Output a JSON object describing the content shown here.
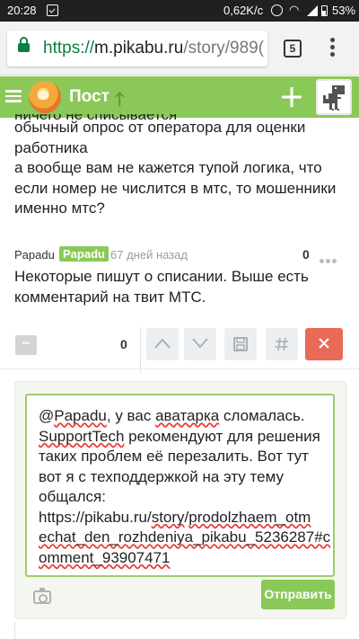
{
  "status_bar": {
    "time": "20:28",
    "network_speed": "0,62K/c",
    "battery": "53%"
  },
  "browser": {
    "url_scheme": "https://",
    "url_host": "m.pikabu.ru",
    "url_path": "/story/989(",
    "tab_count": "5"
  },
  "header": {
    "title": "Пост",
    "up_icon": "arrow-up-icon",
    "add_icon": "plus-icon",
    "accent_color": "#8ac858"
  },
  "post": {
    "cut_line": "ничего не списывается",
    "lines": [
      "обычный опрос от оператора для оценки",
      "работника",
      "а вообще вам не кажется тупой логика, что",
      "если номер не числится в мтс, то мошенники",
      "именно мтс?"
    ]
  },
  "comment": {
    "author": "Papadu",
    "badge": "Papadu",
    "time": "67 дней назад",
    "score": "0",
    "lines": [
      "Некоторые пишут о списании. Выше есть",
      "комментарий на твит МТС."
    ]
  },
  "actions": {
    "minus_label": "−",
    "score": "0",
    "icons": [
      "chevron-up-icon",
      "chevron-down-icon",
      "save-icon",
      "hash-icon",
      "close-icon"
    ]
  },
  "reply": {
    "editor_lines": [
      [
        "@",
        "Papadu",
        ", у вас ",
        "аватарка",
        " сломалась."
      ],
      [
        "",
        "SupportTech",
        " рекомендуют для решения",
        "",
        ""
      ],
      [
        "таких проблем её перезалить. Вот тут",
        "",
        "",
        "",
        ""
      ],
      [
        "вот я с техподдержкой на эту тему",
        "",
        "",
        "",
        ""
      ],
      [
        "общался:",
        "",
        "",
        "",
        ""
      ],
      [
        "https://pikabu.ru/",
        "story",
        "/",
        "prodolzhaem_otm",
        ""
      ],
      [
        "echat_den_rozhdeniya_pikabu_5236287#c",
        "",
        "",
        "",
        ""
      ],
      [
        "omment_93907471",
        "",
        "",
        "",
        ""
      ]
    ],
    "send_label": "Отправить"
  }
}
